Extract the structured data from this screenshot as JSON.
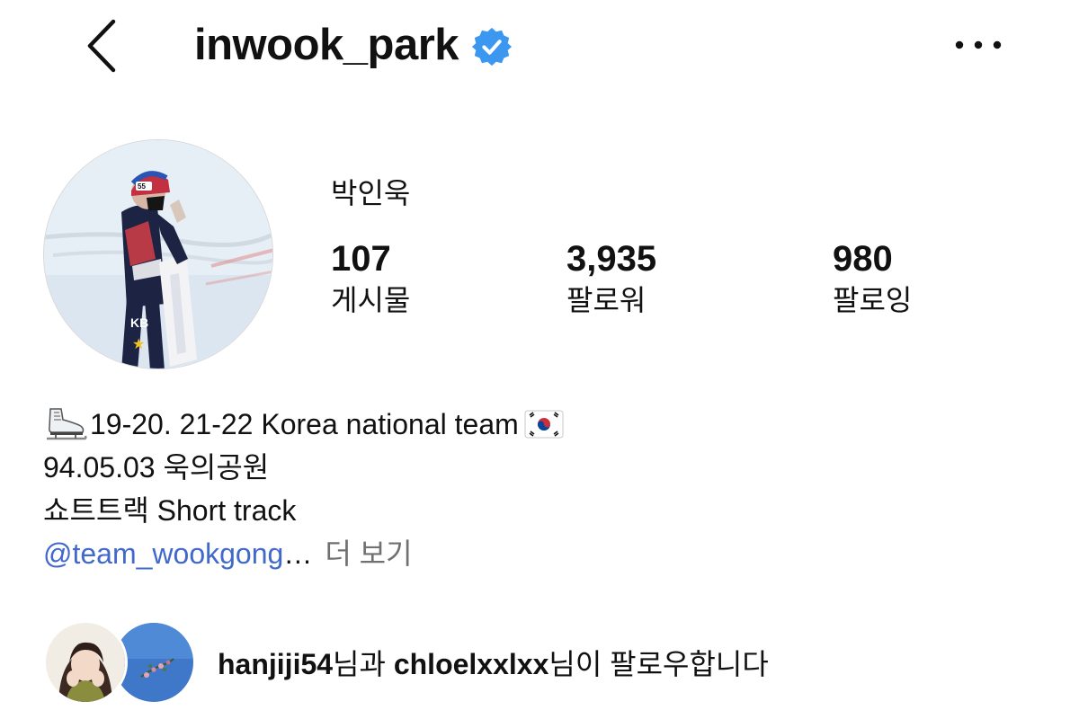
{
  "header": {
    "username": "inwook_park",
    "back_icon": "chevron-left-icon",
    "verified_icon": "verified-badge-icon",
    "more_icon": "more-horizontal-icon"
  },
  "profile": {
    "display_name": "박인욱",
    "stats": {
      "posts": {
        "count": "107",
        "label": "게시물"
      },
      "followers": {
        "count": "3,935",
        "label": "팔로워"
      },
      "following": {
        "count": "980",
        "label": "팔로잉"
      }
    }
  },
  "bio": {
    "line1": "19-20. 21-22 Korea national team",
    "line2": "94.05.03 욱의공원",
    "line3": "쇼트트랙 Short track",
    "mention": "@team_wookgong",
    "ellipsis": "…",
    "more_label": "더 보기"
  },
  "followed_by": {
    "user1": "hanjiji54",
    "connector": "님과 ",
    "user2": "chloelxxlxx",
    "suffix": "님이 팔로우합니다"
  },
  "colors": {
    "link_blue": "#4169cc",
    "verified_blue": "#3b97f0",
    "muted_gray": "#707070"
  }
}
